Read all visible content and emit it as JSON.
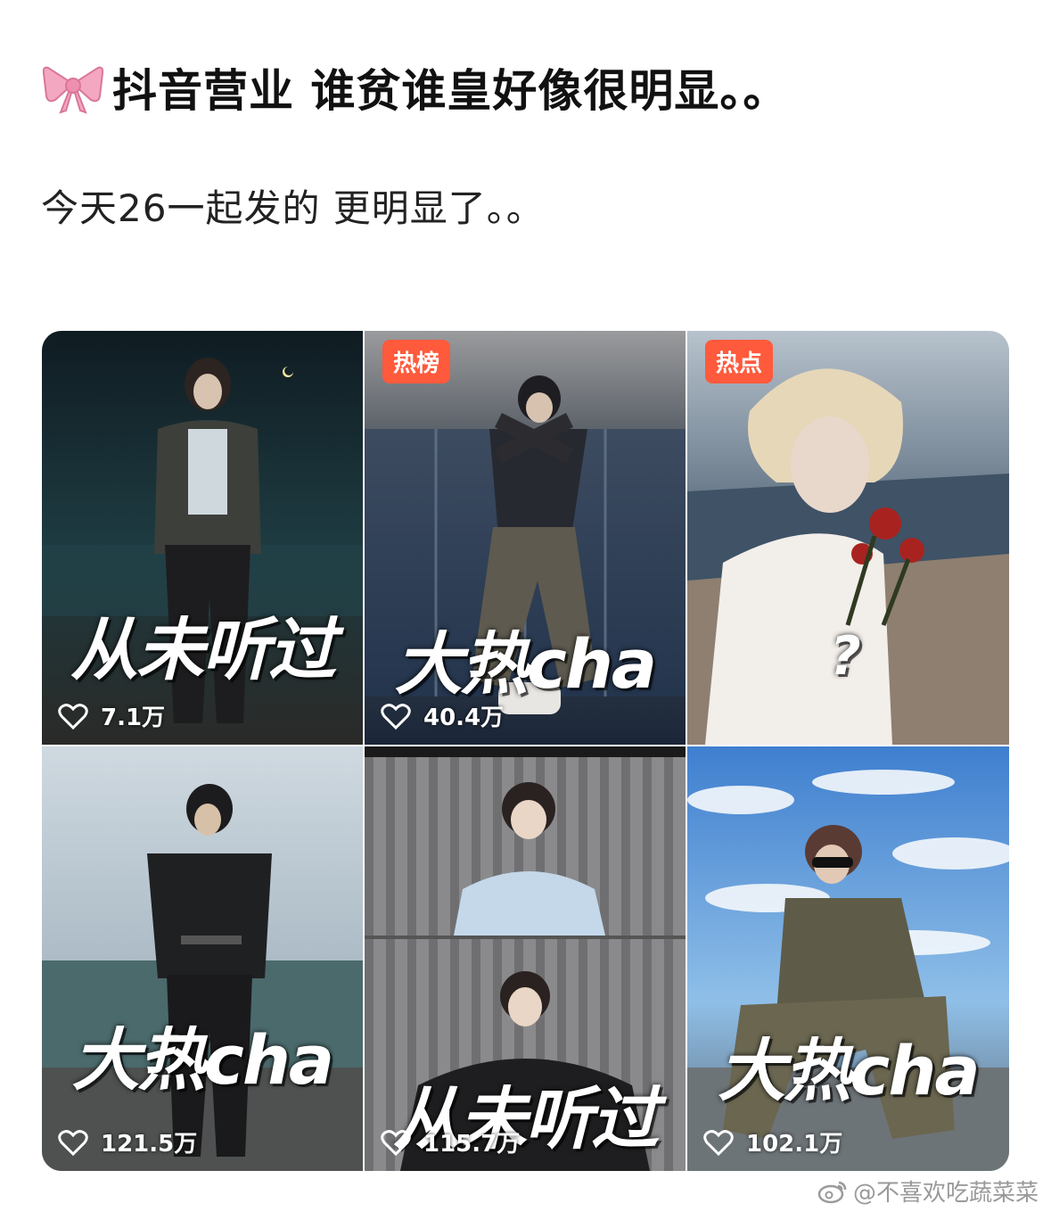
{
  "post": {
    "title": "抖音营业 谁贫谁皇好像很明显。。",
    "title_icon": "pink-bow-icon",
    "body": "今天26一起发的 更明显了。。"
  },
  "videos": [
    {
      "overlay": "从未听过",
      "likes": "7.1万",
      "badge": ""
    },
    {
      "overlay": "大热cha",
      "likes": "40.4万",
      "badge": "热榜"
    },
    {
      "overlay": "?",
      "likes": "",
      "badge": "热点"
    },
    {
      "overlay": "大热cha",
      "likes": "121.5万",
      "badge": ""
    },
    {
      "overlay": "从未听过",
      "likes": "115.7万",
      "badge": ""
    },
    {
      "overlay": "大热cha",
      "likes": "102.1万",
      "badge": ""
    }
  ],
  "watermark": {
    "text": "@不喜欢吃蔬菜菜",
    "icon": "weibo-icon"
  },
  "colors": {
    "badge": "#ff5a3c",
    "bow": "#f4a7c0"
  }
}
